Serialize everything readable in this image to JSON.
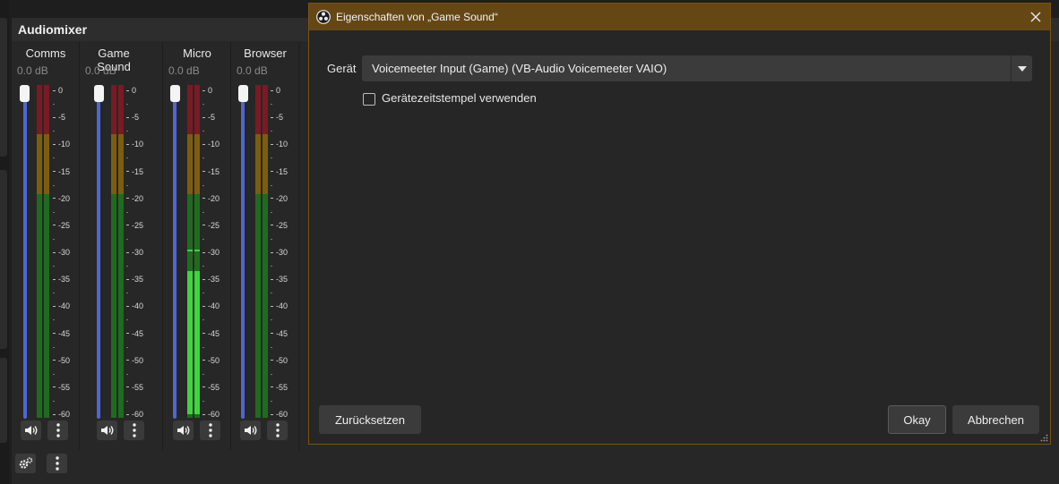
{
  "mixer": {
    "title": "Audiomixer",
    "channels": [
      {
        "name": "Comms",
        "db": "0.0 dB",
        "level": null,
        "peak": null
      },
      {
        "name": "Game Sound",
        "db": "0.0 dB",
        "level": null,
        "peak": null
      },
      {
        "name": "Micro",
        "db": "0.0 dB",
        "level": -34.5,
        "peak": -30.5
      },
      {
        "name": "Browser",
        "db": "0.0 dB",
        "level": null,
        "peak": null
      }
    ],
    "scale": [
      "0",
      "-5",
      "-10",
      "-15",
      "-20",
      "-25",
      "-30",
      "-35",
      "-40",
      "-45",
      "-50",
      "-55",
      "-60"
    ],
    "icons": {
      "mute": "speaker-icon",
      "menu": "kebab-menu-icon",
      "settings": "gear-icon"
    }
  },
  "dialog": {
    "title": "Eigenschaften von „Game Sound“",
    "device_label": "Gerät",
    "device_value": "Voicemeeter Input (Game) (VB-Audio Voicemeeter VAIO)",
    "timestamp_label": "Gerätezeitstempel verwenden",
    "timestamp_checked": false,
    "reset_label": "Zurücksetzen",
    "ok_label": "Okay",
    "cancel_label": "Abbrechen"
  },
  "colors": {
    "accent": "#654716",
    "fader": "#4e66d6",
    "meter_red": "#7a1a24",
    "meter_yellow": "#7c5d10",
    "meter_green": "#1f6b1f",
    "meter_live": "#3fd53f"
  }
}
